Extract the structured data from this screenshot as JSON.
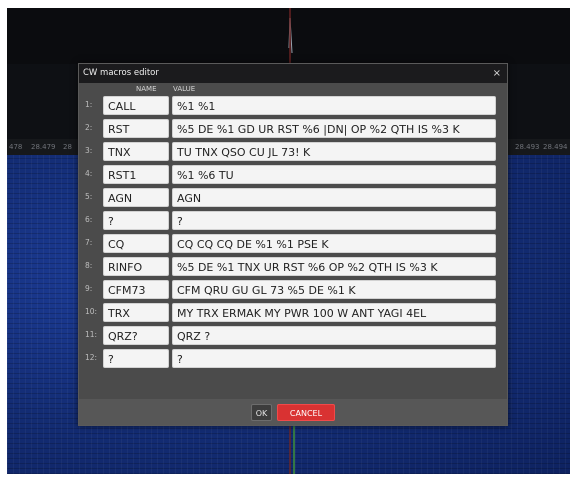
{
  "dialog": {
    "title": "CW macros editor",
    "close_glyph": "×",
    "headers": {
      "name": "NAME",
      "value": "VALUE"
    },
    "rows": [
      {
        "num": "1:",
        "name": "CALL",
        "value": "%1 %1"
      },
      {
        "num": "2:",
        "name": "RST",
        "value": "%5 DE %1 GD UR RST %6 |DN| OP %2 QTH IS %3 K"
      },
      {
        "num": "3:",
        "name": "TNX",
        "value": "TU TNX QSO CU JL 73! K"
      },
      {
        "num": "4:",
        "name": "RST1",
        "value": "%1 %6 TU"
      },
      {
        "num": "5:",
        "name": "AGN",
        "value": "AGN"
      },
      {
        "num": "6:",
        "name": "?",
        "value": "?"
      },
      {
        "num": "7:",
        "name": "CQ",
        "value": "CQ CQ CQ DE  %1 %1 PSE K"
      },
      {
        "num": "8:",
        "name": "RINFO",
        "value": "%5 DE %1 TNX UR RST %6 OP %2 QTH IS %3 K"
      },
      {
        "num": "9:",
        "name": "CFM73",
        "value": "CFM QRU GU GL 73 %5 DE %1 K"
      },
      {
        "num": "10:",
        "name": "TRX",
        "value": "MY TRX ERMAK MY PWR 100 W ANT YAGI 4EL"
      },
      {
        "num": "11:",
        "name": "QRZ?",
        "value": "QRZ ?"
      },
      {
        "num": "12:",
        "name": "?",
        "value": "?"
      }
    ],
    "ok_label": "OK",
    "cancel_label": "CANCEL"
  },
  "scale": {
    "left_labels": [
      "478",
      "28.479",
      "28"
    ],
    "right_labels": [
      "28.493",
      "28.494"
    ]
  },
  "colors": {
    "cancel": "#d93232",
    "waterfall": "#132c73",
    "titlebar": "#1b1b1d"
  }
}
